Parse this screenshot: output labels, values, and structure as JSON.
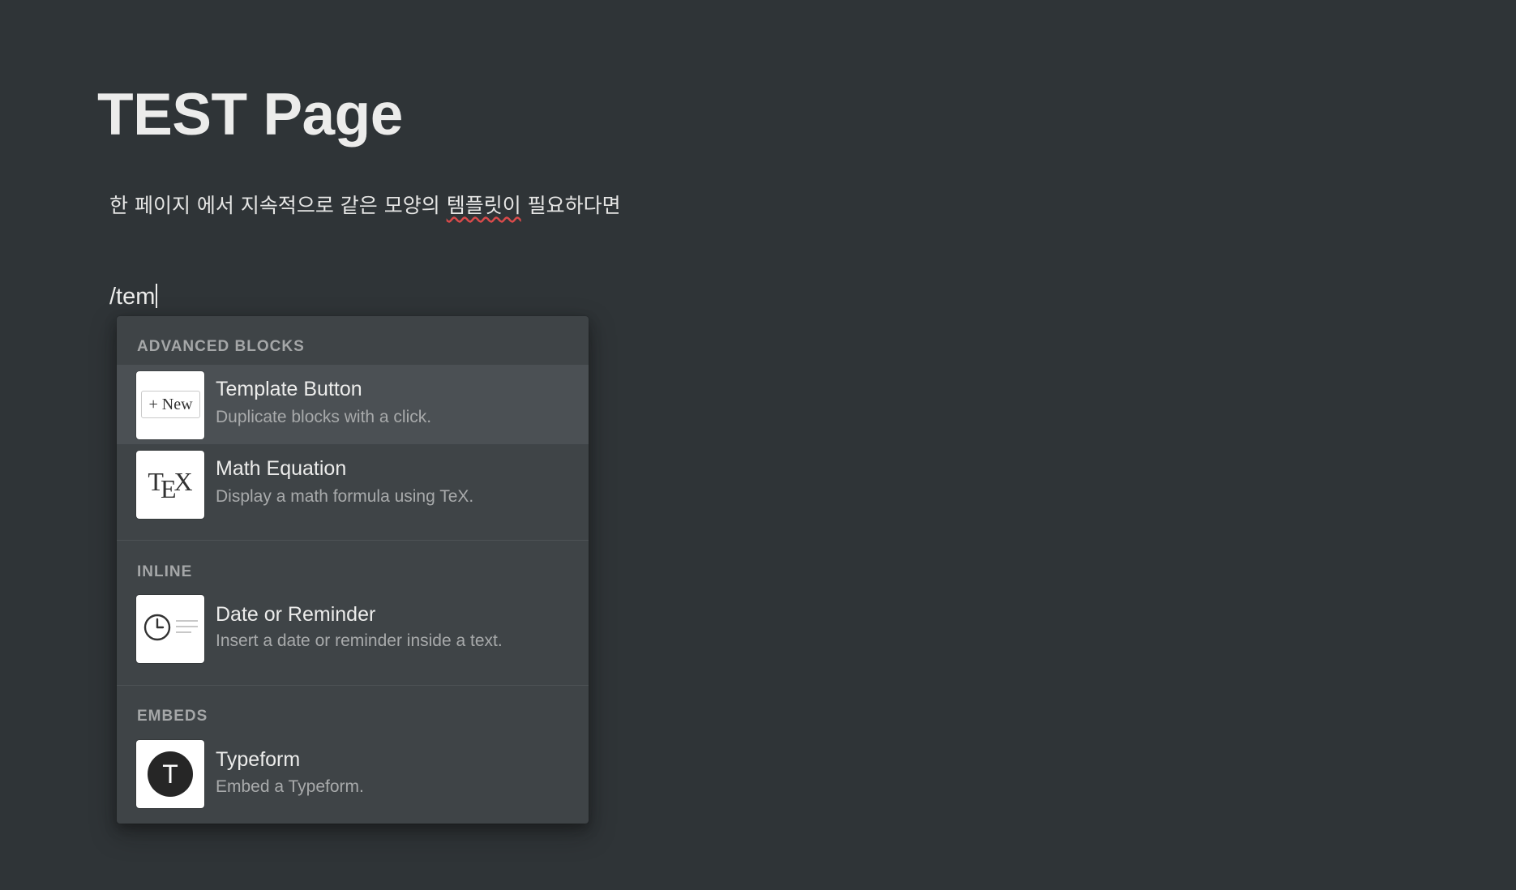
{
  "page": {
    "title": "TEST Page",
    "paragraph_before": "한 페이지 에서 지속적으로 같은 모양의 ",
    "paragraph_misspelled": "템플릿이",
    "paragraph_after": " 필요하다면",
    "slash_command": "/tem"
  },
  "menu": {
    "sections": [
      {
        "header": "ADVANCED BLOCKS",
        "items": [
          {
            "title": "Template Button",
            "description": "Duplicate blocks with a click.",
            "thumb_text": "+ New",
            "selected": true
          },
          {
            "title": "Math Equation",
            "description": "Display a math formula using TeX.",
            "thumb_text_parts": [
              "T",
              "E",
              "X"
            ]
          }
        ]
      },
      {
        "header": "INLINE",
        "items": [
          {
            "title": "Date or Reminder",
            "description": "Insert a date or reminder inside a text.",
            "icon": "clock-icon"
          }
        ]
      },
      {
        "header": "EMBEDS",
        "items": [
          {
            "title": "Typeform",
            "description": "Embed a Typeform.",
            "thumb_text": "T"
          }
        ]
      }
    ]
  },
  "colors": {
    "background": "#2f3437",
    "menu_background": "#3f4447",
    "selected_item": "#4b5054",
    "spellcheck_underline": "#d94a4a"
  }
}
